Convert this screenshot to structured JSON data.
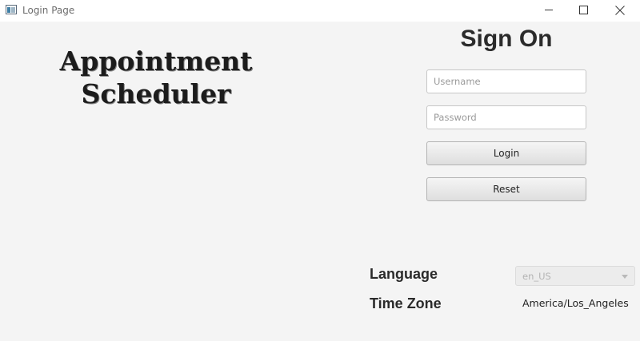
{
  "window": {
    "title": "Login Page",
    "app_icon": "window-app-icon",
    "controls": {
      "minimize": "minimize-icon",
      "maximize": "maximize-icon",
      "close": "close-icon"
    }
  },
  "app_title": {
    "line1": "Appointment",
    "line2": "Scheduler"
  },
  "login": {
    "heading": "Sign On",
    "username_placeholder": "Username",
    "password_placeholder": "Password",
    "login_label": "Login",
    "reset_label": "Reset"
  },
  "locale": {
    "language_label": "Language",
    "language_value": "en_US",
    "timezone_label": "Time Zone",
    "timezone_value": "America/Los_Angeles"
  }
}
